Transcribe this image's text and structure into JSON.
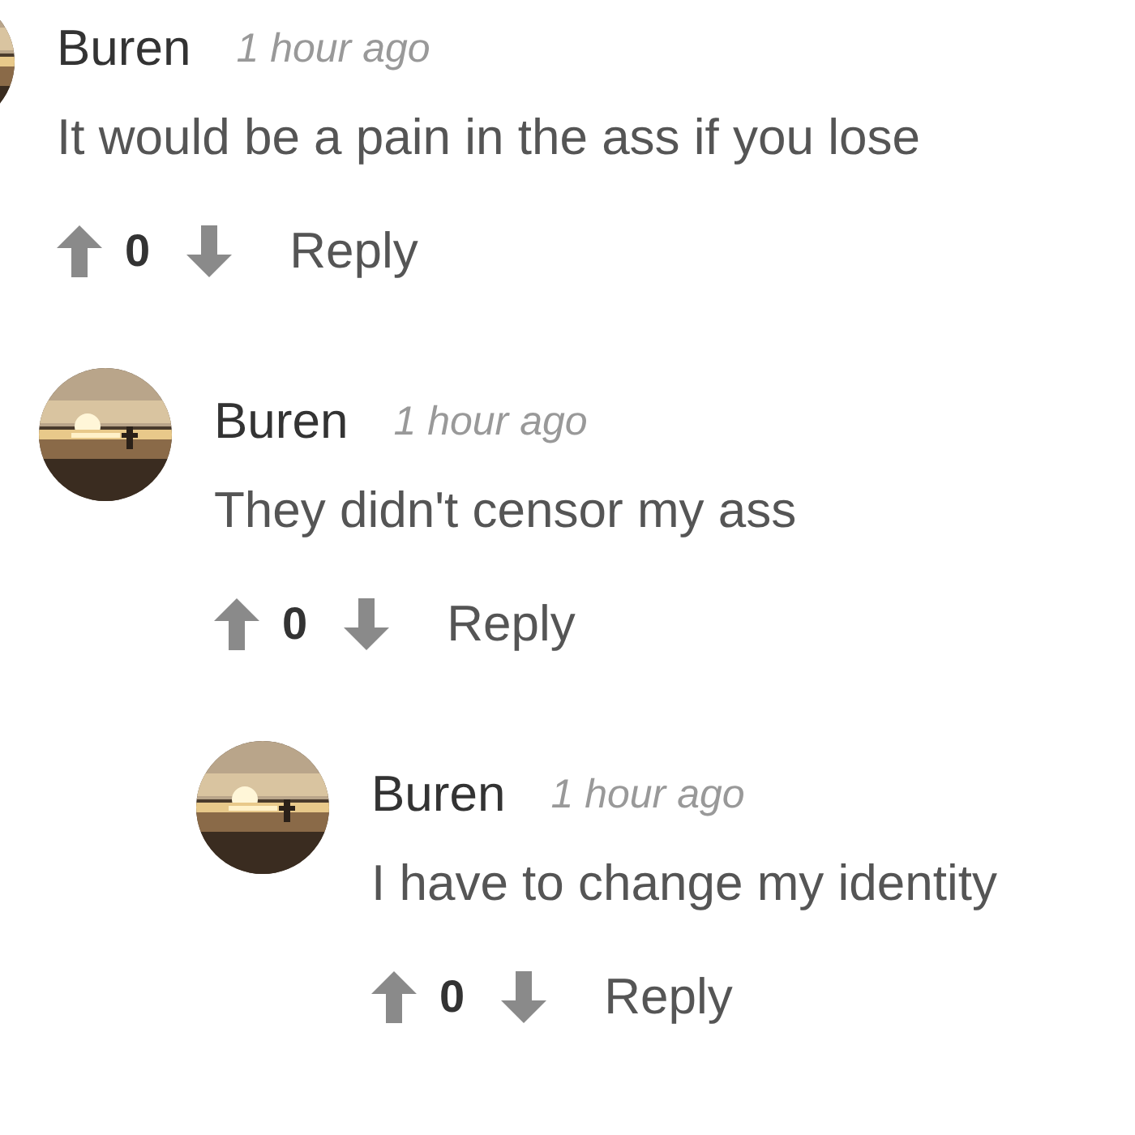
{
  "comments": [
    {
      "author": "Buren",
      "time": "1 hour ago",
      "text": "It would be a pain in the ass if you lose",
      "score": "0",
      "reply": "Reply",
      "children": [
        {
          "author": "Buren",
          "time": "1 hour ago",
          "text": "They didn't censor my ass",
          "score": "0",
          "reply": "Reply",
          "children": [
            {
              "author": "Buren",
              "time": "1 hour ago",
              "text": "I have to change my identity",
              "score": "0",
              "reply": "Reply"
            }
          ]
        }
      ]
    }
  ]
}
